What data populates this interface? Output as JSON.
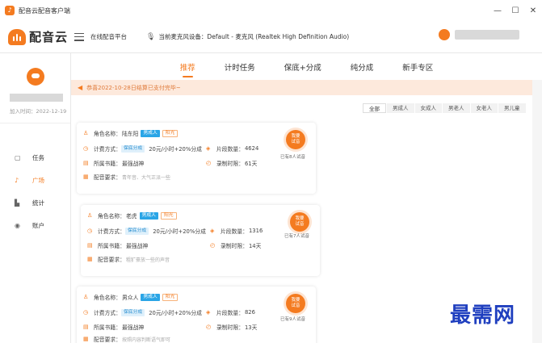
{
  "window": {
    "title": "配音云配音客户端",
    "controls": [
      "—",
      "☐",
      "✕"
    ]
  },
  "header": {
    "logo_text": "配音云",
    "platform_label": "在线配音平台",
    "device_label": "当前麦克风设备：Default - 麦克风 (Realtek High Definition Audio)"
  },
  "sidebar": {
    "join_date": "加入时间：2022-12-19",
    "items": [
      {
        "label": "任务",
        "icon": "▢"
      },
      {
        "label": "广场",
        "icon": "♪"
      },
      {
        "label": "统计",
        "icon": "▙"
      },
      {
        "label": "账户",
        "icon": "◉"
      }
    ]
  },
  "tabs": [
    "推荐",
    "计时任务",
    "保底+分成",
    "纯分成",
    "新手专区"
  ],
  "notice": "恭喜2022-10-28日结算已支付完毕~",
  "filters": [
    "全部",
    "男成人",
    "女成人",
    "男老人",
    "女老人",
    "男儿童"
  ],
  "labels": {
    "role": "角色名称：",
    "billing": "计费方式：",
    "clip_count": "片段数量：",
    "book": "所属书籍：",
    "record_time": "录制时限：",
    "requirement": "配音要求：",
    "join_button": "我要\n试音"
  },
  "cards": [
    {
      "role": "陆东阳",
      "tag1": "男成人",
      "tag2": "阳光",
      "billing_tag": "保底分成",
      "billing": "20元/小时+20%分成",
      "clips": "4624",
      "book": "最强战神",
      "time": "61天",
      "requirement": "青年音、大气正派一些",
      "join_count": "已有8人试音"
    },
    {
      "role": "老虎",
      "tag1": "男成人",
      "tag2": "阳光",
      "billing_tag": "保底分成",
      "billing": "20元/小时+20%分成",
      "clips": "1316",
      "book": "最强战神",
      "time": "14天",
      "requirement": "粗犷豪放一些的声音",
      "join_count": "已有7人试音"
    },
    {
      "role": "男众人",
      "tag1": "男成人",
      "tag2": "阳光",
      "billing_tag": "保底分成",
      "billing": "20元/小时+20%分成",
      "clips": "826",
      "book": "最强战神",
      "time": "13天",
      "requirement": "按照内容判断语气即可",
      "join_count": "已有9人试音"
    }
  ],
  "watermark": "最需网",
  "colors": {
    "accent": "#f47b20",
    "notice_bg": "#fde9dc",
    "tag_blue": "#2aa5e6"
  }
}
